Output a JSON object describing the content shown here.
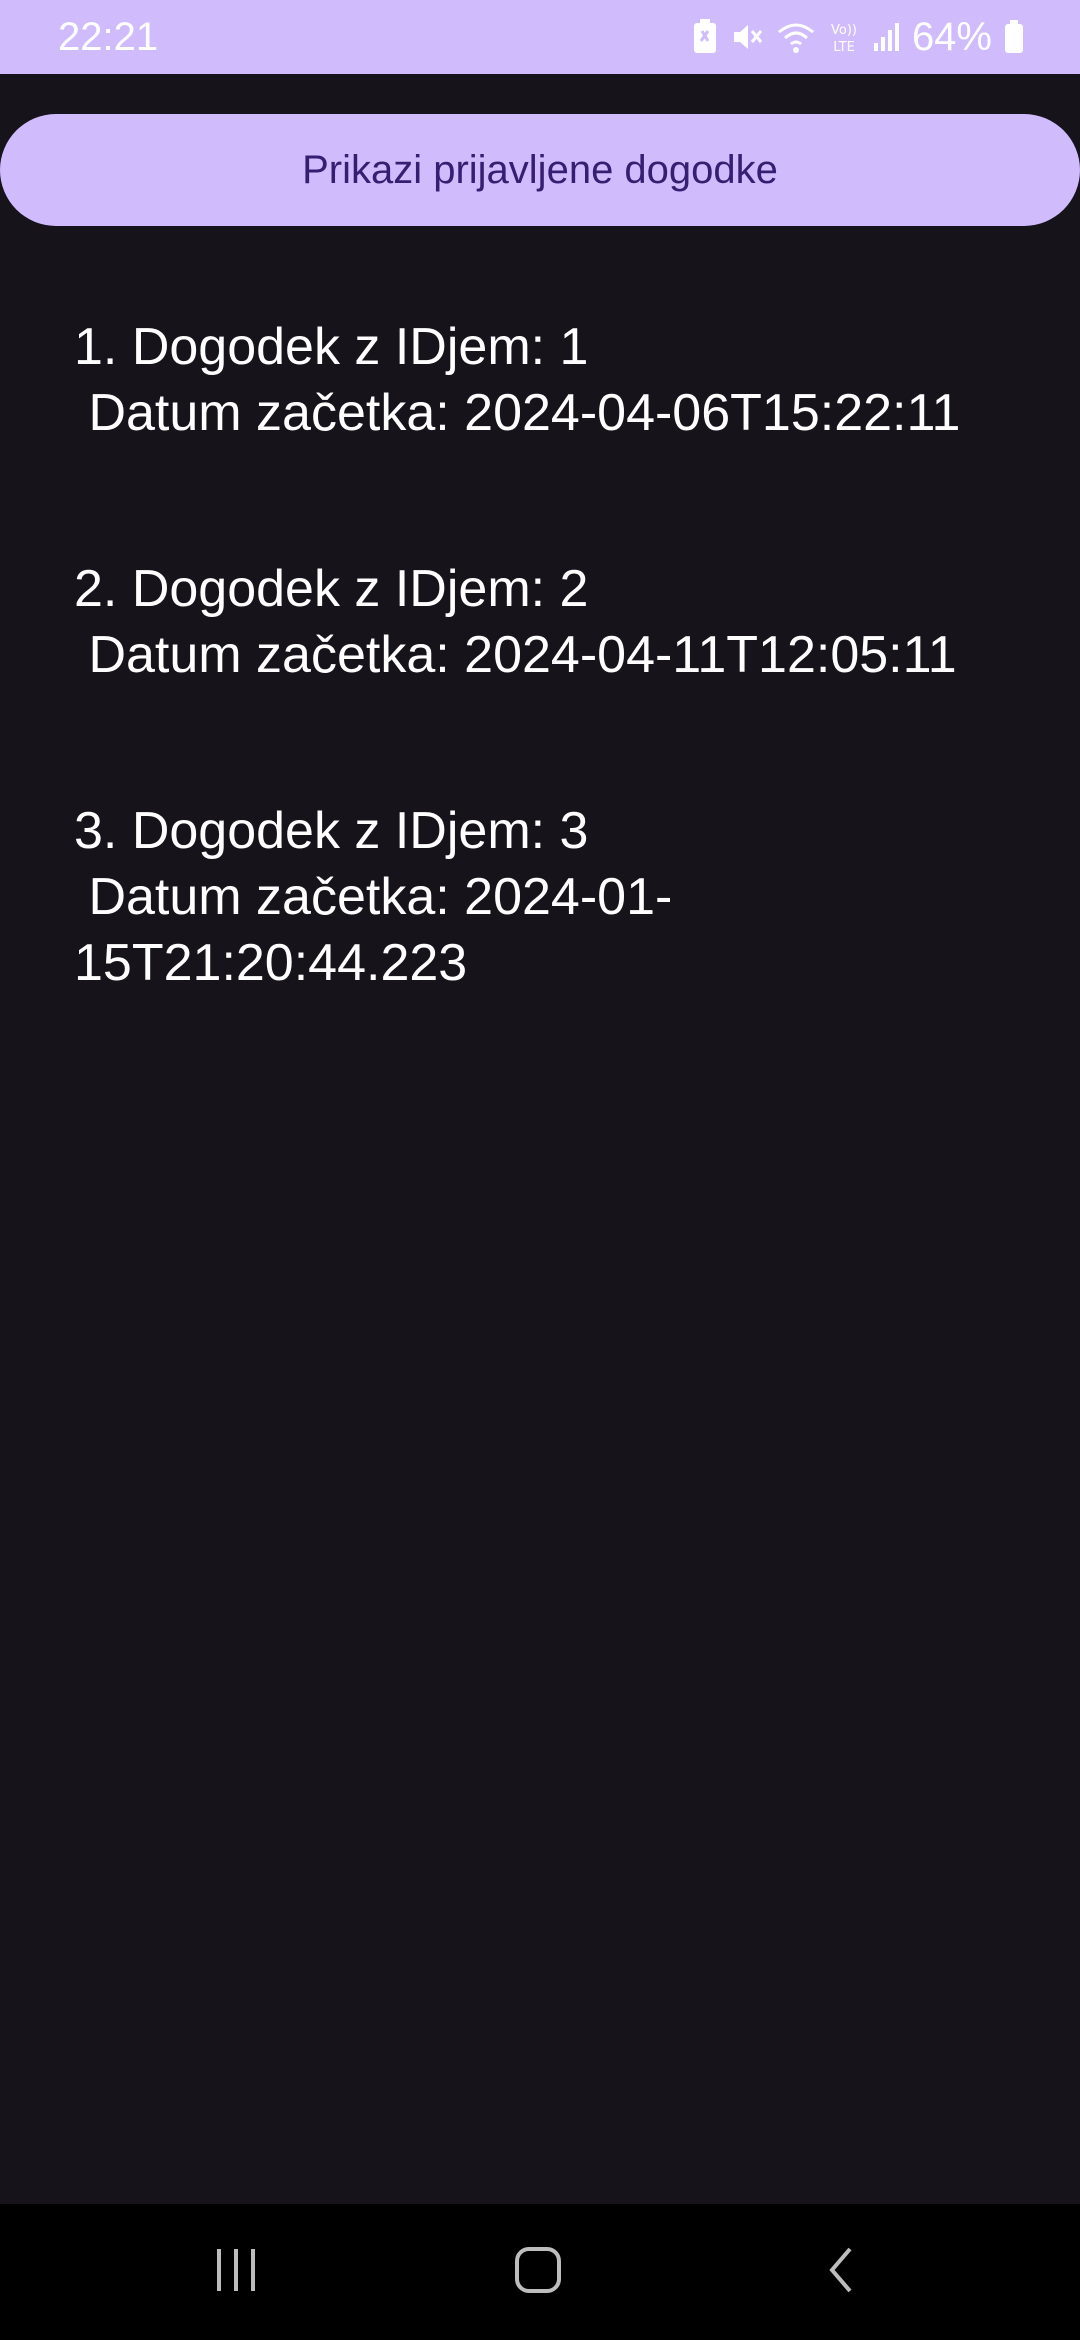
{
  "status_bar": {
    "time": "22:21",
    "battery": "64%",
    "icons": [
      "battery-saver-icon",
      "mute-icon",
      "wifi-icon",
      "volte-icon",
      "signal-icon",
      "battery-icon"
    ]
  },
  "main": {
    "button_label": "Prikazi prijavljene dogodke",
    "events": [
      {
        "title": "1. Dogodek z IDjem: 1",
        "date_line": " Datum začetka: 2024-04-06T15:22:11"
      },
      {
        "title": "2. Dogodek z IDjem: 2",
        "date_line": " Datum začetka: 2024-04-11T12:05:11"
      },
      {
        "title": "3. Dogodek z IDjem: 3",
        "date_line": " Datum začetka: 2024-01-15T21:20:44.223"
      }
    ]
  },
  "nav_bar": {
    "buttons": [
      "recent-apps-icon",
      "home-icon",
      "back-icon"
    ]
  },
  "colors": {
    "accent": "#d0bcfd",
    "button_text": "#381e72",
    "background": "#16131b"
  }
}
